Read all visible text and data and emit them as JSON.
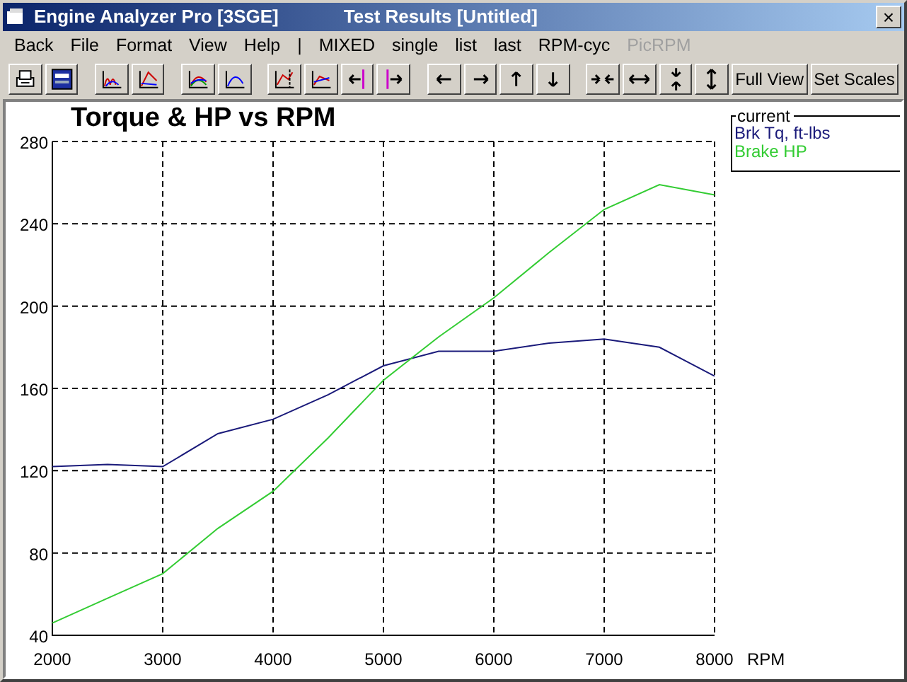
{
  "window": {
    "title": "Engine Analyzer Pro [3SGE]",
    "subtitle": "Test Results [Untitled]",
    "close": "×"
  },
  "menu": [
    {
      "label": "Back",
      "disabled": false
    },
    {
      "label": "File",
      "disabled": false
    },
    {
      "label": "Format",
      "disabled": false
    },
    {
      "label": "View",
      "disabled": false
    },
    {
      "label": "Help",
      "disabled": false
    },
    {
      "label": "|",
      "disabled": false
    },
    {
      "label": "MIXED",
      "disabled": false
    },
    {
      "label": "single",
      "disabled": false
    },
    {
      "label": "list",
      "disabled": false
    },
    {
      "label": "last",
      "disabled": false
    },
    {
      "label": "RPM-cyc",
      "disabled": false
    },
    {
      "label": "PicRPM",
      "disabled": true
    }
  ],
  "toolbar_buttons": [
    "Full View",
    "Set Scales"
  ],
  "legend": {
    "title": "current"
  },
  "chart_data": {
    "type": "line",
    "title": "Torque & HP vs RPM",
    "xlabel": "RPM",
    "x": [
      2000,
      2500,
      3000,
      3500,
      4000,
      4500,
      5000,
      5500,
      6000,
      6500,
      7000,
      7500,
      8000
    ],
    "series": [
      {
        "name": "Brk Tq, ft-lbs",
        "color": "#1a1a7a",
        "values": [
          122,
          123,
          122,
          138,
          145,
          157,
          171,
          178,
          178,
          182,
          184,
          180,
          166
        ]
      },
      {
        "name": "Brake HP",
        "color": "#33cc33",
        "values": [
          46,
          58,
          70,
          92,
          110,
          136,
          164,
          185,
          204,
          226,
          247,
          259,
          254
        ]
      }
    ],
    "xlim": [
      2000,
      8000
    ],
    "ylim": [
      40,
      280
    ],
    "xticks": [
      2000,
      3000,
      4000,
      5000,
      6000,
      7000,
      8000
    ],
    "yticks": [
      40,
      80,
      120,
      160,
      200,
      240,
      280
    ],
    "grid": true
  }
}
